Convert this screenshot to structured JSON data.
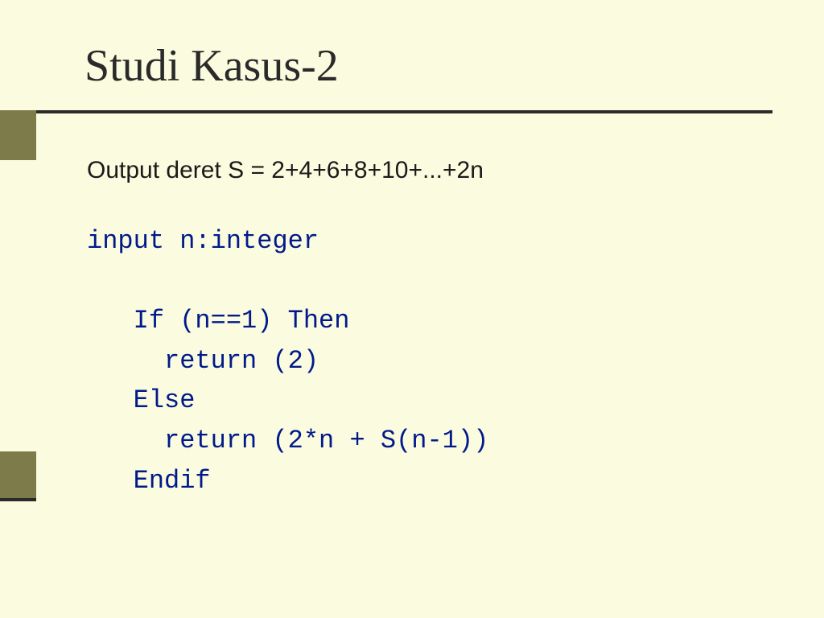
{
  "title": "Studi Kasus-2",
  "description": "Output deret S = 2+4+6+8+10+...+2n",
  "code": {
    "line1": "input n:integer",
    "line2": "   If (n==1) Then",
    "line3": "     return (2)",
    "line4": "   Else",
    "line5": "     return (2*n + S(n-1))",
    "line6": "   Endif"
  }
}
